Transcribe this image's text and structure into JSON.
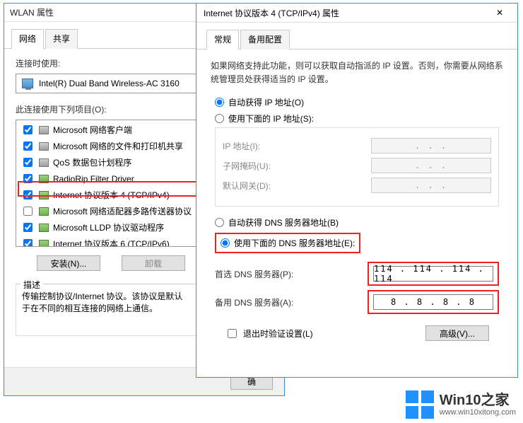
{
  "wlan": {
    "title": "WLAN 属性",
    "tabs": {
      "network": "网络",
      "share": "共享"
    },
    "connect_label": "连接时使用:",
    "adapter": "Intel(R) Dual Band Wireless-AC 3160",
    "items_label": "此连接使用下列项目(O):",
    "items": [
      {
        "checked": true,
        "label": "Microsoft 网络客户端",
        "icon": "grey"
      },
      {
        "checked": true,
        "label": "Microsoft 网络的文件和打印机共享",
        "icon": "grey"
      },
      {
        "checked": true,
        "label": "QoS 数据包计划程序",
        "icon": "grey"
      },
      {
        "checked": true,
        "label": "RadioRip Filter Driver",
        "icon": "green"
      },
      {
        "checked": true,
        "label": "Internet 协议版本 4 (TCP/IPv4)",
        "icon": "green"
      },
      {
        "checked": false,
        "label": "Microsoft 网络适配器多路传送器协议",
        "icon": "green"
      },
      {
        "checked": true,
        "label": "Microsoft LLDP 协议驱动程序",
        "icon": "green"
      },
      {
        "checked": true,
        "label": "Internet 协议版本 6 (TCP/IPv6)",
        "icon": "green"
      }
    ],
    "install": "安装(N)...",
    "uninstall": "卸载",
    "desc_legend": "描述",
    "desc_text": "传输控制协议/Internet 协议。该协议是默认\n于在不同的相互连接的网络上通信。",
    "ok": "确"
  },
  "ipv4": {
    "title": "Internet 协议版本 4 (TCP/IPv4) 属性",
    "tabs": {
      "general": "常规",
      "alt": "备用配置"
    },
    "info": "如果网络支持此功能，则可以获取自动指派的 IP 设置。否则，你需要从网络系统管理员处获得适当的 IP 设置。",
    "ip_auto": "自动获得 IP 地址(O)",
    "ip_manual": "使用下面的 IP 地址(S):",
    "ip_label": "IP 地址(I):",
    "mask_label": "子网掩码(U):",
    "gw_label": "默认网关(D):",
    "ip_value": ".     .     .",
    "mask_value": ".     .     .",
    "gw_value": ".     .     .",
    "dns_auto": "自动获得 DNS 服务器地址(B)",
    "dns_manual": "使用下面的 DNS 服务器地址(E):",
    "dns1_label": "首选 DNS 服务器(P):",
    "dns2_label": "备用 DNS 服务器(A):",
    "dns1_value": "114 . 114 . 114 . 114",
    "dns2_value": "8  .  8  .  8  .  8",
    "validate": "退出时验证设置(L)",
    "advanced": "高级(V)..."
  },
  "watermark": {
    "brand": "Win10之家",
    "url": "www.win10xitong.com"
  }
}
